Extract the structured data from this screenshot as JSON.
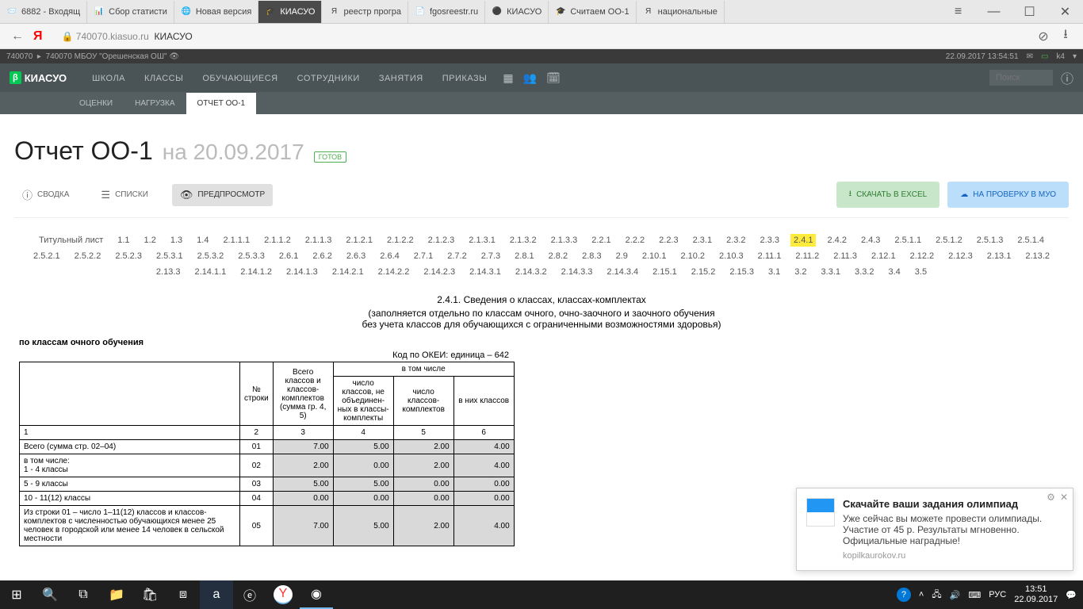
{
  "browser": {
    "tabs": [
      {
        "label": "6882 - Входящ",
        "icon": "📨"
      },
      {
        "label": "Сбор статисти",
        "icon": "📊"
      },
      {
        "label": "Новая версия",
        "icon": "🌐"
      },
      {
        "label": "КИАСУО",
        "icon": "🎓",
        "active": true
      },
      {
        "label": "реестр програ",
        "icon": "Я"
      },
      {
        "label": "fgosreestr.ru",
        "icon": "📄"
      },
      {
        "label": "КИАСУО",
        "icon": "⚫"
      },
      {
        "label": "Считаем ОО-1",
        "icon": "🎓"
      },
      {
        "label": "национальные",
        "icon": "Я"
      }
    ],
    "url_gray": "740070.kiasuo.ru",
    "url_dark": "КИАСУО"
  },
  "topbar": {
    "left_id": "740070",
    "school": "740070 МБОУ \"Орешенская ОШ\"",
    "datetime": "22.09.2017 13:54:51",
    "user": "k4"
  },
  "nav": {
    "logo_badge": "β",
    "logo": "КИАСУО",
    "items": [
      "ШКОЛА",
      "КЛАССЫ",
      "ОБУЧАЮЩИЕСЯ",
      "СОТРУДНИКИ",
      "ЗАНЯТИЯ",
      "ПРИКАЗЫ"
    ],
    "search_placeholder": "Поиск"
  },
  "subnav": {
    "items": [
      "ОЦЕНКИ",
      "НАГРУЗКА",
      "ОТЧЕТ ОО-1"
    ],
    "active": 2
  },
  "page": {
    "title": "Отчет ОО-1",
    "date_prefix": "на ",
    "date": "20.09.2017",
    "status": "ГОТОВ"
  },
  "toolbar": {
    "summary": "СВОДКА",
    "lists": "СПИСКИ",
    "preview": "ПРЕДПРОСМОТР",
    "excel": "СКАЧАТЬ В EXCEL",
    "check": "НА ПРОВЕРКУ В МУО"
  },
  "sections": {
    "active": "2.4.1",
    "items": [
      "Титульный лист",
      "1.1",
      "1.2",
      "1.3",
      "1.4",
      "2.1.1.1",
      "2.1.1.2",
      "2.1.1.3",
      "2.1.2.1",
      "2.1.2.2",
      "2.1.2.3",
      "2.1.3.1",
      "2.1.3.2",
      "2.1.3.3",
      "2.2.1",
      "2.2.2",
      "2.2.3",
      "2.3.1",
      "2.3.2",
      "2.3.3",
      "2.4.1",
      "2.4.2",
      "2.4.3",
      "2.5.1.1",
      "2.5.1.2",
      "2.5.1.3",
      "2.5.1.4",
      "2.5.2.1",
      "2.5.2.2",
      "2.5.2.3",
      "2.5.3.1",
      "2.5.3.2",
      "2.5.3.3",
      "2.6.1",
      "2.6.2",
      "2.6.3",
      "2.6.4",
      "2.7.1",
      "2.7.2",
      "2.7.3",
      "2.8.1",
      "2.8.2",
      "2.8.3",
      "2.9",
      "2.10.1",
      "2.10.2",
      "2.10.3",
      "2.11.1",
      "2.11.2",
      "2.11.3",
      "2.12.1",
      "2.12.2",
      "2.12.3",
      "2.13.1",
      "2.13.2",
      "2.13.3",
      "2.14.1.1",
      "2.14.1.2",
      "2.14.1.3",
      "2.14.2.1",
      "2.14.2.2",
      "2.14.2.3",
      "2.14.3.1",
      "2.14.3.2",
      "2.14.3.3",
      "2.14.3.4",
      "2.15.1",
      "2.15.2",
      "2.15.3",
      "3.1",
      "3.2",
      "3.3.1",
      "3.3.2",
      "3.4",
      "3.5"
    ]
  },
  "report": {
    "heading": "2.4.1. Сведения о классах, классах-комплектах",
    "sub1": "(заполняется отдельно по классам очного, очно-заочного и заочного обучения",
    "sub2": "без учета классов для обучающихся с ограниченными возможностями здоровья)",
    "label": "по классам очного обучения",
    "okei": "Код по ОКЕИ: единица – 642",
    "header_group": "в том числе",
    "cols": [
      "№ строки",
      "Всего классов и классов-комплектов (сумма гр. 4, 5)",
      "число классов, не объединен-ных в классы-комплекты",
      "число классов-комплектов",
      "в них классов"
    ],
    "num_row": [
      "1",
      "2",
      "3",
      "4",
      "5",
      "6"
    ],
    "rows": [
      {
        "label": "Всего (сумма стр. 02–04)",
        "n": "01",
        "v": [
          "7.00",
          "5.00",
          "2.00",
          "4.00"
        ]
      },
      {
        "label": "в том числе:\n1 - 4 классы",
        "n": "02",
        "v": [
          "2.00",
          "0.00",
          "2.00",
          "4.00"
        ]
      },
      {
        "label": "5 - 9 классы",
        "n": "03",
        "v": [
          "5.00",
          "5.00",
          "0.00",
          "0.00"
        ]
      },
      {
        "label": "10 - 11(12) классы",
        "n": "04",
        "v": [
          "0.00",
          "0.00",
          "0.00",
          "0.00"
        ]
      },
      {
        "label": "Из строки 01 – число 1–11(12) классов и классов-комплектов с численностью обучающихся менее 25 человек в городской или менее 14 человек в сельской местности",
        "n": "05",
        "v": [
          "7.00",
          "5.00",
          "2.00",
          "4.00"
        ]
      }
    ]
  },
  "notification": {
    "title": "Скачайте ваши задания олимпиад",
    "body": "Уже сейчас вы можете провести олимпиады. Участие от 45 р. Результаты мгновенно. Официальные наградные!",
    "source": "kopilkaurokov.ru"
  },
  "taskbar": {
    "lang": "РУС",
    "time": "13:51",
    "date": "22.09.2017"
  }
}
